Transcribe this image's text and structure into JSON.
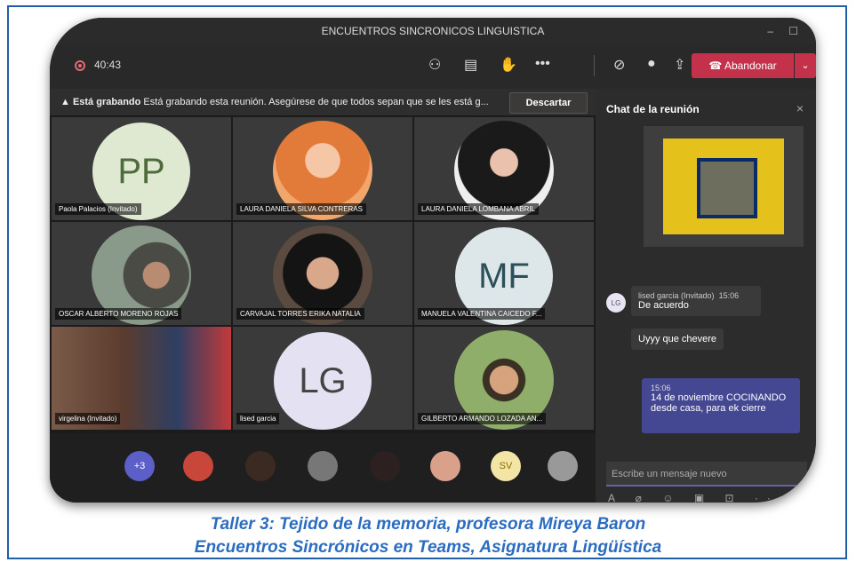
{
  "window": {
    "title": "ENCUENTROS SINCRONICOS LINGUISTICA",
    "minimize": "–",
    "maximize": "☐"
  },
  "toolbar": {
    "timer": "40:43",
    "icons": [
      "people-icon",
      "chat-icon",
      "raise-hand-icon",
      "more-icon",
      "camera-off-icon",
      "mic-icon",
      "share-icon"
    ],
    "leave_label": "Abandonar",
    "leave_dropdown": "⌄"
  },
  "banner": {
    "warning": "▲ Está grabando",
    "text": "Está grabando esta reunión. Asegúrese de que todos sepan que se les está g...",
    "dismiss": "Descartar"
  },
  "participants": [
    {
      "name": "Paola Palacios (Invitado)",
      "initials": "PP",
      "bg": "#dfe9d2",
      "fg": "#4f6b3b",
      "kind": "initials"
    },
    {
      "name": "LAURA DANIELA SILVA CONTRERAS",
      "initials": "",
      "bg": "#f1a66c",
      "kind": "photo"
    },
    {
      "name": "LAURA DANIELA LOMBANA ABRIL",
      "initials": "",
      "bg": "#2a2a2a",
      "kind": "photo"
    },
    {
      "name": "OSCAR ALBERTO MORENO ROJAS",
      "initials": "",
      "bg": "#6f7d6a",
      "kind": "photo"
    },
    {
      "name": "CARVAJAL TORRES ERIKA NATALIA",
      "initials": "",
      "bg": "#3b2d2a",
      "kind": "photo"
    },
    {
      "name": "MANUELA VALENTINA CAICEDO F...",
      "initials": "MF",
      "bg": "#dde6e8",
      "fg": "#2d4f5a",
      "kind": "initials"
    },
    {
      "name": "virgelina (Invitado)",
      "initials": "",
      "bg": "#6d4b3a",
      "kind": "photo"
    },
    {
      "name": "lised garcia",
      "initials": "LG",
      "bg": "#e4e1f3",
      "fg": "#444444",
      "kind": "initials"
    },
    {
      "name": "GILBERTO ARMANDO LOZADA AN...",
      "initials": "",
      "bg": "#8fae69",
      "kind": "photo"
    }
  ],
  "bottom": {
    "overflow": "+3",
    "overflow_color": "#5b5fc7",
    "sv_initials": "SV",
    "sv_color": "#f3e5a6"
  },
  "chat": {
    "title": "Chat de la reunión",
    "close": "×",
    "sender": "lised garcia (Invitado)",
    "sender_time": "15:06",
    "sender_initials": "LG",
    "msg1": "De acuerdo",
    "msg2": "Uyyy que chevere",
    "mine_time": "15:06",
    "mine_text": "14 de noviembre COCINANDO desde casa, para ek cierre",
    "placeholder": "Escribe un mensaje nuevo",
    "compose_tools": "A ⌀ ☺ ▣ ⊡ ···"
  },
  "caption": {
    "line1": "Taller 3: Tejido de la memoria, profesora Mireya Baron",
    "line2": "Encuentros Sincrónicos  en Teams, Asignatura Lingüística"
  },
  "colors": {
    "accent": "#6264a7",
    "leave": "#c4314b",
    "caption": "#2b6cc0"
  }
}
